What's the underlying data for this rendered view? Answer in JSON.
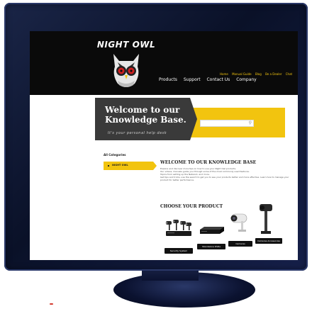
{
  "brand": {
    "name": "NIGHT OWL"
  },
  "top_links": [
    "Home",
    "Manual Guide",
    "Blog",
    "Be a Dealer",
    "Chat"
  ],
  "nav": [
    "Products",
    "Support",
    "Contact Us",
    "Company"
  ],
  "hero": {
    "title_line1": "Welcome to our",
    "title_line2": "Knowledge Base.",
    "subtitle": "It's your personal help desk",
    "search_placeholder": ""
  },
  "sidebar": {
    "heading": "All Categories",
    "items": [
      {
        "label": "NIGHT OWL"
      }
    ]
  },
  "welcome": {
    "title": "WELCOME TO OUR KNOWLEDGE BASE",
    "body": [
      "Explore and discover more tips on how to use your Night Owl products.",
      "Our videos, manuals guide you through some of the most commonly used features.",
      "Topics from setting up the Network, and more.",
      "Get tips and tricks, use the search to get you to see your products better and more effective. Learn how to manage your",
      "product for better performance."
    ]
  },
  "choose": {
    "title": "CHOOSE YOUR PRODUCT",
    "products": [
      {
        "label": "Security System",
        "icon": "security-system-kit"
      },
      {
        "label": "Standalone DVRs",
        "icon": "dvr-recorder"
      },
      {
        "label": "Cameras",
        "icon": "bullet-camera"
      },
      {
        "label": "Cameras Accessories",
        "icon": "camera-mount"
      }
    ]
  },
  "colors": {
    "accent": "#f2c40f",
    "header": "#0a0a0a",
    "hero_dark": "#3a3a3a",
    "bezel": "#0a1128"
  }
}
